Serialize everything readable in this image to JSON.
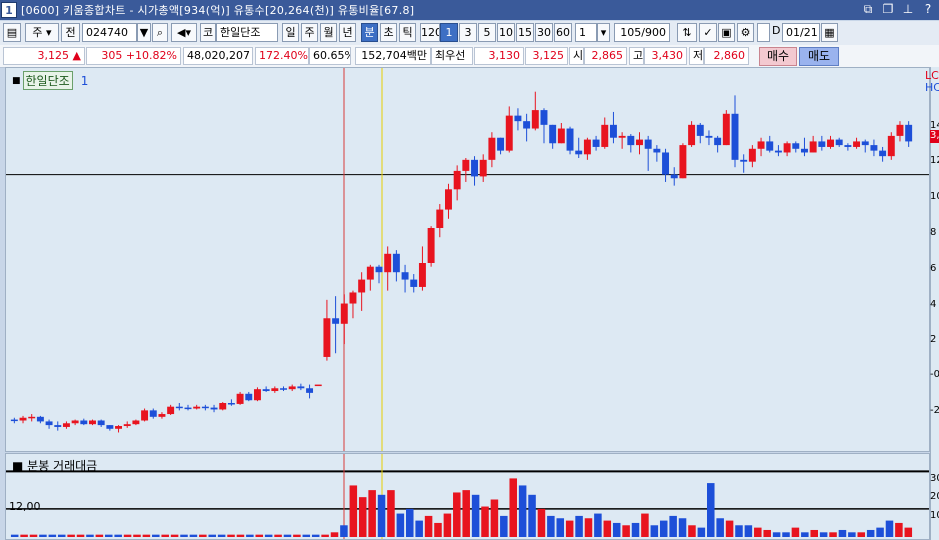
{
  "window": {
    "number": "1",
    "title": "[0600] 키움종합차트 - 시가총액[934(억)] 유통수[20,264(천)] 유통비율[67.8]",
    "icons": [
      "restore-icon",
      "duplicate-icon",
      "pin-icon",
      "help-icon"
    ]
  },
  "toolbar": {
    "period_select": "주",
    "all_label": "전",
    "code_value": "024740",
    "code_dropdown": "▼",
    "search_icon": "search-icon",
    "sound_icon": "sound-icon",
    "market_label": "코",
    "stock_name": "한일단조",
    "period_tabs": [
      "일",
      "주",
      "월",
      "년",
      "분",
      "초",
      "틱"
    ],
    "selected_period": "분",
    "interval_buttons": [
      "120",
      "1",
      "3",
      "5",
      "10",
      "15",
      "30",
      "60"
    ],
    "selected_interval": "1",
    "custom_interval": "1",
    "count": "105",
    "max_count": "/900",
    "date_checkbox_label": "D",
    "date_value": "01/21"
  },
  "quote": {
    "price": "3,125",
    "arrow": "▲",
    "change": "305",
    "change_pct": "+10.82%",
    "volume": "48,020,207",
    "vol_ratio": "172.40%",
    "turnover": "60.65%",
    "amount": "152,704백만",
    "quote_type": "최우선",
    "ask": "3,130",
    "bid": "3,125",
    "open_label": "시",
    "open": "2,865",
    "high_label": "고",
    "high": "3,430",
    "low_label": "저",
    "low": "2,860",
    "buy_label": "매수",
    "sell_label": "매도"
  },
  "price_panel": {
    "legend_name": "한일단조",
    "legend_suffix": "1",
    "axis_labels": [
      "LC",
      "HC",
      "14",
      "12",
      "10",
      "8",
      "6",
      "4",
      "2",
      "-0",
      "-2"
    ],
    "current_marker": "3,"
  },
  "volume_panel": {
    "legend": "분봉 거래대금",
    "ref_label": "12,00",
    "axis_labels": [
      "30",
      "20",
      "10"
    ]
  },
  "colors": {
    "up": "#e8141f",
    "down": "#1d4fd8",
    "bg": "#dde9f3",
    "title_bar": "#3a5a9a"
  },
  "chart_data": {
    "type": "candlestick",
    "candles": [
      {
        "o": -2,
        "h": -1.9,
        "l": -2.2,
        "c": -2.05
      },
      {
        "o": -2.05,
        "h": -1.8,
        "l": -2.2,
        "c": -1.9
      },
      {
        "o": -1.9,
        "h": -1.7,
        "l": -2.1,
        "c": -1.85
      },
      {
        "o": -1.85,
        "h": -1.8,
        "l": -2.2,
        "c": -2.1
      },
      {
        "o": -2.1,
        "h": -2.0,
        "l": -2.5,
        "c": -2.3
      },
      {
        "o": -2.3,
        "h": -2.1,
        "l": -2.6,
        "c": -2.4
      },
      {
        "o": -2.4,
        "h": -2.1,
        "l": -2.5,
        "c": -2.2
      },
      {
        "o": -2.2,
        "h": -2.0,
        "l": -2.3,
        "c": -2.05
      },
      {
        "o": -2.05,
        "h": -1.95,
        "l": -2.3,
        "c": -2.25
      },
      {
        "o": -2.25,
        "h": -2.0,
        "l": -2.3,
        "c": -2.05
      },
      {
        "o": -2.05,
        "h": -2.0,
        "l": -2.4,
        "c": -2.3
      },
      {
        "o": -2.3,
        "h": -2.3,
        "l": -2.6,
        "c": -2.5
      },
      {
        "o": -2.5,
        "h": -2.3,
        "l": -2.7,
        "c": -2.35
      },
      {
        "o": -2.35,
        "h": -2.1,
        "l": -2.45,
        "c": -2.25
      },
      {
        "o": -2.25,
        "h": -2.0,
        "l": -2.3,
        "c": -2.05
      },
      {
        "o": -2.05,
        "h": -1.4,
        "l": -2.1,
        "c": -1.5
      },
      {
        "o": -1.5,
        "h": -1.4,
        "l": -1.95,
        "c": -1.85
      },
      {
        "o": -1.85,
        "h": -1.6,
        "l": -1.95,
        "c": -1.7
      },
      {
        "o": -1.7,
        "h": -1.2,
        "l": -1.75,
        "c": -1.3
      },
      {
        "o": -1.3,
        "h": -1.1,
        "l": -1.5,
        "c": -1.35
      },
      {
        "o": -1.35,
        "h": -1.2,
        "l": -1.5,
        "c": -1.4
      },
      {
        "o": -1.4,
        "h": -1.2,
        "l": -1.45,
        "c": -1.3
      },
      {
        "o": -1.3,
        "h": -1.2,
        "l": -1.5,
        "c": -1.35
      },
      {
        "o": -1.35,
        "h": -1.2,
        "l": -1.6,
        "c": -1.45
      },
      {
        "o": -1.45,
        "h": -1.05,
        "l": -1.5,
        "c": -1.1
      },
      {
        "o": -1.1,
        "h": -0.9,
        "l": -1.25,
        "c": -1.15
      },
      {
        "o": -1.15,
        "h": -0.5,
        "l": -1.2,
        "c": -0.6
      },
      {
        "o": -0.6,
        "h": -0.5,
        "l": -1.0,
        "c": -0.95
      },
      {
        "o": -0.95,
        "h": -0.25,
        "l": -1.0,
        "c": -0.35
      },
      {
        "o": -0.35,
        "h": -0.2,
        "l": -0.5,
        "c": -0.45
      },
      {
        "o": -0.45,
        "h": -0.2,
        "l": -0.55,
        "c": -0.3
      },
      {
        "o": -0.3,
        "h": -0.2,
        "l": -0.45,
        "c": -0.35
      },
      {
        "o": -0.35,
        "h": -0.1,
        "l": -0.45,
        "c": -0.2
      },
      {
        "o": -0.2,
        "h": -0.05,
        "l": -0.4,
        "c": -0.3
      },
      {
        "o": -0.3,
        "h": -0.1,
        "l": -0.85,
        "c": -0.55
      },
      {
        "o": -0.1,
        "h": -0.1,
        "l": -0.1,
        "c": -0.1
      },
      {
        "o": 1.4,
        "h": 4.5,
        "l": 1.2,
        "c": 3.5
      },
      {
        "o": 3.5,
        "h": 4.7,
        "l": 1.6,
        "c": 3.2
      },
      {
        "o": 3.2,
        "h": 4.8,
        "l": 2.1,
        "c": 4.3
      },
      {
        "o": 4.3,
        "h": 5.0,
        "l": 3.5,
        "c": 4.9
      },
      {
        "o": 4.9,
        "h": 6.0,
        "l": 3.9,
        "c": 5.6
      },
      {
        "o": 5.6,
        "h": 6.4,
        "l": 5.0,
        "c": 6.3
      },
      {
        "o": 6.3,
        "h": 6.4,
        "l": 5.4,
        "c": 6.0
      },
      {
        "o": 6.0,
        "h": 7.4,
        "l": 5.0,
        "c": 7.0
      },
      {
        "o": 7.0,
        "h": 7.2,
        "l": 5.5,
        "c": 6.0
      },
      {
        "o": 6.0,
        "h": 6.4,
        "l": 4.9,
        "c": 5.6
      },
      {
        "o": 5.6,
        "h": 5.9,
        "l": 4.9,
        "c": 5.2
      },
      {
        "o": 5.2,
        "h": 7.4,
        "l": 5.0,
        "c": 6.5
      },
      {
        "o": 6.5,
        "h": 8.5,
        "l": 6.3,
        "c": 8.4
      },
      {
        "o": 8.4,
        "h": 9.7,
        "l": 7.9,
        "c": 9.4
      },
      {
        "o": 9.4,
        "h": 10.8,
        "l": 8.9,
        "c": 10.5
      },
      {
        "o": 10.5,
        "h": 11.8,
        "l": 9.9,
        "c": 11.5
      },
      {
        "o": 11.5,
        "h": 12.2,
        "l": 10.9,
        "c": 12.1
      },
      {
        "o": 12.1,
        "h": 12.3,
        "l": 10.7,
        "c": 11.2
      },
      {
        "o": 11.2,
        "h": 12.4,
        "l": 10.9,
        "c": 12.1
      },
      {
        "o": 12.1,
        "h": 13.6,
        "l": 11.7,
        "c": 13.3
      },
      {
        "o": 13.3,
        "h": 13.3,
        "l": 12.4,
        "c": 12.6
      },
      {
        "o": 12.6,
        "h": 15.0,
        "l": 12.5,
        "c": 14.5
      },
      {
        "o": 14.5,
        "h": 14.9,
        "l": 13.7,
        "c": 14.2
      },
      {
        "o": 14.2,
        "h": 14.6,
        "l": 13.1,
        "c": 13.8
      },
      {
        "o": 13.8,
        "h": 15.8,
        "l": 13.7,
        "c": 14.8
      },
      {
        "o": 14.8,
        "h": 14.9,
        "l": 13.0,
        "c": 14.0
      },
      {
        "o": 14.0,
        "h": 14.0,
        "l": 12.7,
        "c": 13.0
      },
      {
        "o": 13.0,
        "h": 14.1,
        "l": 13.0,
        "c": 13.8
      },
      {
        "o": 13.8,
        "h": 13.9,
        "l": 12.4,
        "c": 12.6
      },
      {
        "o": 12.6,
        "h": 13.3,
        "l": 12.2,
        "c": 12.4
      },
      {
        "o": 12.4,
        "h": 13.3,
        "l": 12.1,
        "c": 13.2
      },
      {
        "o": 13.2,
        "h": 13.4,
        "l": 12.6,
        "c": 12.8
      },
      {
        "o": 12.8,
        "h": 14.4,
        "l": 12.7,
        "c": 14.0
      },
      {
        "o": 14.0,
        "h": 14.7,
        "l": 13.0,
        "c": 13.3
      },
      {
        "o": 13.3,
        "h": 13.6,
        "l": 12.7,
        "c": 13.4
      },
      {
        "o": 13.4,
        "h": 13.5,
        "l": 12.5,
        "c": 12.9
      },
      {
        "o": 12.9,
        "h": 13.6,
        "l": 12.4,
        "c": 13.2
      },
      {
        "o": 13.2,
        "h": 13.4,
        "l": 11.5,
        "c": 12.7
      },
      {
        "o": 12.7,
        "h": 12.9,
        "l": 12.0,
        "c": 12.5
      },
      {
        "o": 12.5,
        "h": 12.7,
        "l": 10.9,
        "c": 11.3
      },
      {
        "o": 11.3,
        "h": 11.7,
        "l": 10.7,
        "c": 11.1
      },
      {
        "o": 11.1,
        "h": 13.0,
        "l": 11.1,
        "c": 12.9
      },
      {
        "o": 12.9,
        "h": 14.2,
        "l": 12.8,
        "c": 14.0
      },
      {
        "o": 14.0,
        "h": 14.1,
        "l": 13.0,
        "c": 13.4
      },
      {
        "o": 13.4,
        "h": 13.7,
        "l": 12.9,
        "c": 13.3
      },
      {
        "o": 13.3,
        "h": 13.4,
        "l": 12.5,
        "c": 12.9
      },
      {
        "o": 12.9,
        "h": 14.8,
        "l": 12.9,
        "c": 14.6
      },
      {
        "o": 14.6,
        "h": 15.6,
        "l": 11.7,
        "c": 12.1
      },
      {
        "o": 12.1,
        "h": 12.4,
        "l": 11.4,
        "c": 12.0
      },
      {
        "o": 12.0,
        "h": 12.9,
        "l": 11.7,
        "c": 12.7
      },
      {
        "o": 12.7,
        "h": 13.3,
        "l": 12.3,
        "c": 13.1
      },
      {
        "o": 13.1,
        "h": 13.4,
        "l": 12.5,
        "c": 12.6
      },
      {
        "o": 12.6,
        "h": 12.9,
        "l": 12.3,
        "c": 12.5
      },
      {
        "o": 12.5,
        "h": 13.1,
        "l": 12.3,
        "c": 13.0
      },
      {
        "o": 13.0,
        "h": 13.1,
        "l": 12.5,
        "c": 12.7
      },
      {
        "o": 12.7,
        "h": 13.3,
        "l": 12.3,
        "c": 12.5
      },
      {
        "o": 12.5,
        "h": 13.4,
        "l": 12.5,
        "c": 13.1
      },
      {
        "o": 13.1,
        "h": 13.4,
        "l": 12.6,
        "c": 12.8
      },
      {
        "o": 12.8,
        "h": 13.4,
        "l": 12.7,
        "c": 13.2
      },
      {
        "o": 13.2,
        "h": 13.3,
        "l": 12.8,
        "c": 12.9
      },
      {
        "o": 12.9,
        "h": 13.0,
        "l": 12.6,
        "c": 12.8
      },
      {
        "o": 12.8,
        "h": 13.3,
        "l": 12.7,
        "c": 13.1
      },
      {
        "o": 13.1,
        "h": 13.2,
        "l": 12.5,
        "c": 12.9
      },
      {
        "o": 12.9,
        "h": 13.2,
        "l": 12.3,
        "c": 12.6
      },
      {
        "o": 12.6,
        "h": 12.8,
        "l": 12.0,
        "c": 12.3
      },
      {
        "o": 12.3,
        "h": 13.6,
        "l": 12.1,
        "c": 13.4
      },
      {
        "o": 13.4,
        "h": 14.2,
        "l": 13.1,
        "c": 14.0
      },
      {
        "o": 14.0,
        "h": 14.2,
        "l": 12.8,
        "c": 13.1
      }
    ],
    "volume": [
      1,
      1,
      1,
      1,
      1,
      1,
      1,
      1,
      1,
      1,
      1,
      1,
      1,
      1,
      1,
      1,
      1,
      1,
      1,
      1,
      1,
      1,
      1,
      1,
      1,
      1,
      1,
      1,
      1,
      1,
      1,
      1,
      1,
      1,
      2,
      5,
      22,
      17,
      20,
      18,
      20,
      10,
      12,
      7,
      9,
      6,
      10,
      19,
      20,
      18,
      13,
      16,
      9,
      25,
      22,
      18,
      12,
      9,
      8,
      7,
      9,
      8,
      10,
      7,
      6,
      5,
      6,
      10,
      5,
      7,
      9,
      8,
      5,
      4,
      23,
      8,
      7,
      5,
      5,
      4,
      3,
      2,
      2,
      4,
      2,
      3,
      2,
      2,
      3,
      2,
      2,
      3,
      4,
      7,
      6,
      4
    ],
    "volume_colors": "up/down by candle",
    "y_range": [
      -3,
      16
    ],
    "volume_ref_lines": [
      12,
      28
    ]
  }
}
